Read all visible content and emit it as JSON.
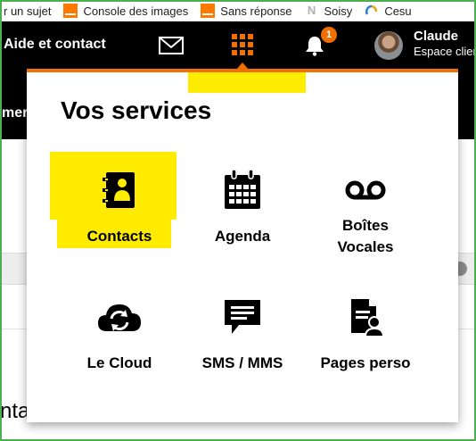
{
  "bookmarks": [
    {
      "label": "r un sujet",
      "icon": "none"
    },
    {
      "label": "Console des images",
      "icon": "orange-logo-icon"
    },
    {
      "label": "Sans réponse",
      "icon": "orange-logo-icon"
    },
    {
      "label": "Soisy",
      "icon": "soisy-n-icon"
    },
    {
      "label": "Cesu",
      "icon": "cesu-icon"
    }
  ],
  "header": {
    "help_link": "Aide et contact",
    "notification_count": "1",
    "user_name": "Claude",
    "user_subtitle": "Espace client"
  },
  "background": {
    "band_text": "mer",
    "big_text": "nta"
  },
  "panel": {
    "title": "Vos services",
    "services": [
      {
        "label": "Contacts",
        "icon": "contacts-book-icon",
        "selected": true
      },
      {
        "label": "Agenda",
        "icon": "calendar-icon"
      },
      {
        "label": "Boîtes Vocales",
        "line1": "Boîtes",
        "line2": "Vocales",
        "icon": "voicemail-icon"
      },
      {
        "label": "Le Cloud",
        "icon": "cloud-sync-icon"
      },
      {
        "label": "SMS / MMS",
        "icon": "sms-bubble-icon"
      },
      {
        "label": "Pages perso",
        "icon": "pages-perso-icon"
      }
    ]
  },
  "colors": {
    "accent_orange": "#f16e00",
    "highlight_yellow": "#ffeb00",
    "header_black": "#000000"
  }
}
